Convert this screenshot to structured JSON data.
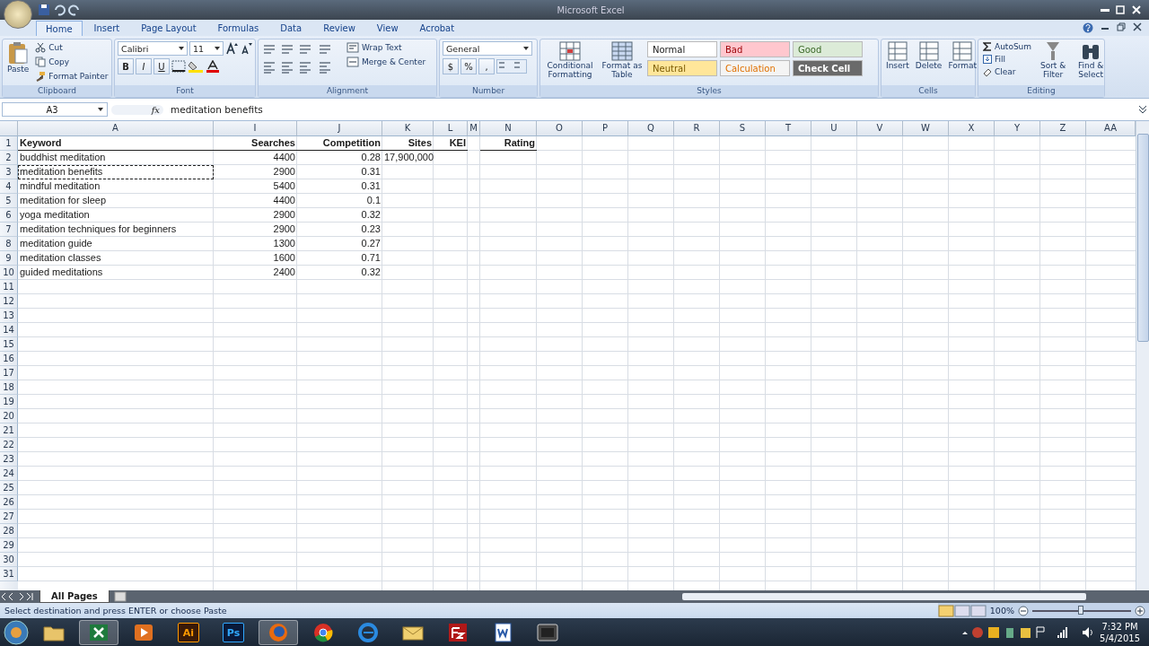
{
  "window": {
    "title": "Microsoft Excel"
  },
  "ribbon_tabs": [
    {
      "label": "Home",
      "selected": true
    },
    {
      "label": "Insert",
      "selected": false
    },
    {
      "label": "Page Layout",
      "selected": false
    },
    {
      "label": "Formulas",
      "selected": false
    },
    {
      "label": "Data",
      "selected": false
    },
    {
      "label": "Review",
      "selected": false
    },
    {
      "label": "View",
      "selected": false
    },
    {
      "label": "Acrobat",
      "selected": false
    }
  ],
  "ribbon": {
    "clipboard": {
      "paste": "Paste",
      "cut": "Cut",
      "copy": "Copy",
      "format_painter": "Format Painter",
      "label": "Clipboard"
    },
    "font": {
      "name": "Calibri",
      "size": "11",
      "bold": "B",
      "italic": "I",
      "underline": "U",
      "label": "Font"
    },
    "alignment": {
      "wrap_text": "Wrap Text",
      "merge_center": "Merge & Center",
      "label": "Alignment"
    },
    "number": {
      "format": "General",
      "currency": "$",
      "percent": "%",
      "comma": ",",
      "label": "Number"
    },
    "styles": {
      "conditional_formatting": "Conditional Formatting",
      "format_as_table": "Format as Table",
      "label": "Styles",
      "gallery": [
        {
          "label": "Normal",
          "kind": "normal",
          "color": "#ffffff"
        },
        {
          "label": "Bad",
          "kind": "bad",
          "color": "#ffc7ce"
        },
        {
          "label": "Good",
          "kind": "good",
          "color": "#dcebd8"
        },
        {
          "label": "Neutral",
          "kind": "neutral",
          "color": "#ffe69a"
        },
        {
          "label": "Calculation",
          "kind": "calculation",
          "color": "#f4f4f4"
        },
        {
          "label": "Check Cell",
          "kind": "check",
          "color": "#6a6a6a"
        }
      ]
    },
    "cells": {
      "insert": "Insert",
      "delete": "Delete",
      "format": "Format",
      "label": "Cells"
    },
    "editing": {
      "autosum": "AutoSum",
      "fill": "Fill",
      "clear": "Clear",
      "sort_filter": "Sort & Filter",
      "find_select": "Find & Select",
      "label": "Editing"
    }
  },
  "formula_bar": {
    "name_box": "A3",
    "fx": "fx",
    "value": "meditation benefits"
  },
  "columns": [
    {
      "letter": "A"
    },
    {
      "letter": "I"
    },
    {
      "letter": "J"
    },
    {
      "letter": "K"
    },
    {
      "letter": "L"
    },
    {
      "letter": "M"
    },
    {
      "letter": "N"
    },
    {
      "letter": "O"
    },
    {
      "letter": "P"
    },
    {
      "letter": "Q"
    },
    {
      "letter": "R"
    },
    {
      "letter": "S"
    },
    {
      "letter": "T"
    },
    {
      "letter": "U"
    },
    {
      "letter": "V"
    },
    {
      "letter": "W"
    },
    {
      "letter": "X"
    },
    {
      "letter": "Y"
    },
    {
      "letter": "Z"
    },
    {
      "letter": "AA"
    }
  ],
  "rows": [
    {
      "number": "1",
      "copied": false,
      "keyword": "Keyword",
      "searches": "Searches",
      "competition": "Competition",
      "sites": "Sites",
      "kei": "KEI",
      "rating": "Rating"
    },
    {
      "number": "2",
      "copied": false,
      "keyword": "buddhist meditation",
      "searches": "4400",
      "competition": "0.28",
      "sites": "17,900,000"
    },
    {
      "number": "3",
      "copied": true,
      "keyword": "meditation benefits",
      "searches": "2900",
      "competition": "0.31"
    },
    {
      "number": "4",
      "copied": false,
      "keyword": "mindful meditation",
      "searches": "5400",
      "competition": "0.31"
    },
    {
      "number": "5",
      "copied": false,
      "keyword": "meditation for sleep",
      "searches": "4400",
      "competition": "0.1"
    },
    {
      "number": "6",
      "copied": false,
      "keyword": "yoga meditation",
      "searches": "2900",
      "competition": "0.32"
    },
    {
      "number": "7",
      "copied": false,
      "keyword": "meditation techniques for beginners",
      "searches": "2900",
      "competition": "0.23"
    },
    {
      "number": "8",
      "copied": false,
      "keyword": "meditation guide",
      "searches": "1300",
      "competition": "0.27"
    },
    {
      "number": "9",
      "copied": false,
      "keyword": "meditation classes",
      "searches": "1600",
      "competition": "0.71"
    },
    {
      "number": "10",
      "copied": false,
      "keyword": "guided meditations",
      "searches": "2400",
      "competition": "0.32"
    },
    {
      "number": "11",
      "copied": false
    },
    {
      "number": "12",
      "copied": false
    },
    {
      "number": "13",
      "copied": false
    },
    {
      "number": "14",
      "copied": false
    },
    {
      "number": "15",
      "copied": false
    },
    {
      "number": "16",
      "copied": false
    },
    {
      "number": "17",
      "copied": false
    },
    {
      "number": "18",
      "copied": false
    },
    {
      "number": "19",
      "copied": false
    },
    {
      "number": "20",
      "copied": false
    },
    {
      "number": "21",
      "copied": false
    },
    {
      "number": "22",
      "copied": false
    },
    {
      "number": "23",
      "copied": false
    },
    {
      "number": "24",
      "copied": false
    },
    {
      "number": "25",
      "copied": false
    },
    {
      "number": "26",
      "copied": false
    },
    {
      "number": "27",
      "copied": false
    },
    {
      "number": "28",
      "copied": false
    },
    {
      "number": "29",
      "copied": false
    },
    {
      "number": "30",
      "copied": false
    },
    {
      "number": "31",
      "copied": false
    }
  ],
  "sheet_tabs": [
    {
      "label": "All Pages",
      "selected": true
    }
  ],
  "status_bar": {
    "message": "Select destination and press ENTER or choose Paste",
    "zoom": "100%",
    "zoom_slider": {
      "level": 0.5
    }
  },
  "taskbar": {
    "apps": [
      {
        "kind": "folder",
        "selected": false
      },
      {
        "kind": "excel",
        "selected": true
      },
      {
        "kind": "media",
        "selected": false
      },
      {
        "kind": "illustrator",
        "label": "Ai",
        "selected": false
      },
      {
        "kind": "photoshop",
        "label": "Ps",
        "selected": false
      },
      {
        "kind": "firefox",
        "selected": true
      },
      {
        "kind": "chrome",
        "selected": false
      },
      {
        "kind": "ie",
        "selected": false
      },
      {
        "kind": "mail",
        "selected": false
      },
      {
        "kind": "filezilla",
        "selected": false
      },
      {
        "kind": "word",
        "selected": false
      },
      {
        "kind": "app",
        "selected": false
      }
    ],
    "time": "7:32 PM",
    "date": "5/4/2015"
  }
}
